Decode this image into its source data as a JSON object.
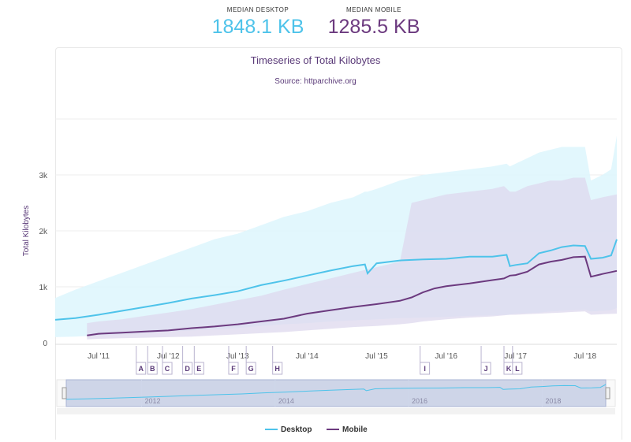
{
  "header": {
    "desktop_label": "MEDIAN DESKTOP",
    "desktop_value": "1848.1 KB",
    "mobile_label": "MEDIAN MOBILE",
    "mobile_value": "1285.5 KB"
  },
  "colors": {
    "desktop": "#4ec3ea",
    "mobile": "#6c3a7f",
    "desktop_band": "#dff6fd",
    "mobile_band": "#ddd8ee",
    "title": "#5a3a78"
  },
  "chart_data": {
    "type": "area",
    "title": "Timeseries of Total Kilobytes",
    "subtitle": "Source: httparchive.org",
    "xlabel": "",
    "ylabel": "Total Kilobytes",
    "ylim": [
      0,
      4000
    ],
    "xlim": [
      "2010-11-15",
      "2018-12-15"
    ],
    "yticks": [
      {
        "value": 0,
        "label": "0"
      },
      {
        "value": 1000,
        "label": "1k"
      },
      {
        "value": 2000,
        "label": "2k"
      },
      {
        "value": 3000,
        "label": "3k"
      }
    ],
    "xticks": [
      {
        "date": "2011-07-01",
        "label": "Jul '11"
      },
      {
        "date": "2012-07-01",
        "label": "Jul '12"
      },
      {
        "date": "2013-07-01",
        "label": "Jul '13"
      },
      {
        "date": "2014-07-01",
        "label": "Jul '14"
      },
      {
        "date": "2015-07-01",
        "label": "Jul '15"
      },
      {
        "date": "2016-07-01",
        "label": "Jul '16"
      },
      {
        "date": "2017-07-01",
        "label": "Jul '17"
      },
      {
        "date": "2018-07-01",
        "label": "Jul '18"
      }
    ],
    "series": [
      {
        "name": "Desktop",
        "x": [
          "2010-11-15",
          "2011-03-01",
          "2011-07-01",
          "2011-11-01",
          "2012-03-01",
          "2012-07-01",
          "2012-11-01",
          "2013-03-01",
          "2013-07-01",
          "2013-11-01",
          "2014-03-01",
          "2014-07-01",
          "2014-11-01",
          "2015-03-01",
          "2015-05-01",
          "2015-05-15",
          "2015-07-01",
          "2015-11-01",
          "2016-03-01",
          "2016-07-01",
          "2016-11-01",
          "2017-03-01",
          "2017-05-15",
          "2017-06-01",
          "2017-07-01",
          "2017-09-01",
          "2017-11-01",
          "2018-01-01",
          "2018-03-01",
          "2018-05-01",
          "2018-07-01",
          "2018-08-01",
          "2018-10-01",
          "2018-11-15",
          "2018-12-15"
        ],
        "values": [
          410,
          440,
          500,
          570,
          640,
          710,
          790,
          850,
          920,
          1030,
          1110,
          1200,
          1290,
          1370,
          1400,
          1240,
          1420,
          1470,
          1490,
          1500,
          1540,
          1540,
          1570,
          1370,
          1390,
          1420,
          1600,
          1650,
          1710,
          1740,
          1730,
          1500,
          1520,
          1560,
          1848
        ],
        "p10": [
          100,
          110,
          130,
          150,
          170,
          200,
          220,
          240,
          260,
          300,
          330,
          350,
          380,
          400,
          410,
          410,
          420,
          440,
          450,
          460,
          480,
          490,
          500,
          500,
          520,
          530,
          540,
          560,
          570,
          580,
          590,
          560,
          570,
          580,
          620
        ],
        "p90": [
          800,
          950,
          1100,
          1250,
          1400,
          1550,
          1700,
          1850,
          1950,
          2100,
          2250,
          2350,
          2500,
          2600,
          2700,
          2700,
          2750,
          2900,
          3000,
          3050,
          3100,
          3150,
          3200,
          3150,
          3200,
          3300,
          3400,
          3450,
          3500,
          3500,
          3500,
          2900,
          3000,
          3100,
          3700
        ]
      },
      {
        "name": "Mobile",
        "x": [
          "2011-05-01",
          "2011-07-01",
          "2011-11-01",
          "2012-03-01",
          "2012-07-01",
          "2012-11-01",
          "2013-03-01",
          "2013-07-01",
          "2013-11-01",
          "2014-03-01",
          "2014-07-01",
          "2014-11-01",
          "2015-03-01",
          "2015-07-01",
          "2015-11-01",
          "2016-01-01",
          "2016-03-01",
          "2016-05-01",
          "2016-07-01",
          "2016-11-01",
          "2017-03-01",
          "2017-05-01",
          "2017-06-01",
          "2017-07-01",
          "2017-09-01",
          "2017-11-01",
          "2018-01-01",
          "2018-03-01",
          "2018-05-01",
          "2018-07-01",
          "2018-08-01",
          "2018-10-01",
          "2018-12-15"
        ],
        "values": [
          130,
          160,
          180,
          200,
          220,
          260,
          290,
          330,
          380,
          430,
          520,
          580,
          640,
          690,
          750,
          810,
          900,
          970,
          1010,
          1060,
          1120,
          1150,
          1200,
          1210,
          1270,
          1400,
          1450,
          1480,
          1530,
          1540,
          1180,
          1230,
          1285
        ],
        "p10": [
          60,
          70,
          80,
          90,
          100,
          110,
          130,
          150,
          170,
          190,
          220,
          250,
          280,
          300,
          330,
          350,
          380,
          400,
          420,
          450,
          470,
          490,
          500,
          500,
          510,
          520,
          530,
          540,
          550,
          560,
          500,
          510,
          520
        ],
        "p90": [
          350,
          380,
          420,
          480,
          540,
          600,
          680,
          760,
          840,
          950,
          1050,
          1150,
          1250,
          1350,
          1450,
          2500,
          2550,
          2600,
          2650,
          2700,
          2750,
          2800,
          2700,
          2700,
          2800,
          2850,
          2900,
          2900,
          2950,
          2950,
          2550,
          2600,
          2650
        ]
      }
    ],
    "annotations": [
      {
        "label": "A",
        "date": "2012-01-15"
      },
      {
        "label": "B",
        "date": "2012-03-15"
      },
      {
        "label": "C",
        "date": "2012-06-01"
      },
      {
        "label": "D",
        "date": "2012-09-15"
      },
      {
        "label": "E",
        "date": "2012-11-15"
      },
      {
        "label": "F",
        "date": "2013-05-15"
      },
      {
        "label": "G",
        "date": "2013-08-15"
      },
      {
        "label": "H",
        "date": "2014-01-01"
      },
      {
        "label": "I",
        "date": "2016-02-15"
      },
      {
        "label": "J",
        "date": "2017-01-01"
      },
      {
        "label": "K",
        "date": "2017-05-01"
      },
      {
        "label": "L",
        "date": "2017-06-15"
      }
    ],
    "navigator": {
      "labels": [
        {
          "date": "2012-01-01",
          "label": "2012"
        },
        {
          "date": "2014-01-01",
          "label": "2014"
        },
        {
          "date": "2016-01-01",
          "label": "2016"
        },
        {
          "date": "2018-01-01",
          "label": "2018"
        }
      ]
    },
    "legend": [
      "Desktop",
      "Mobile"
    ],
    "legend_position": "bottom-center",
    "grid": true
  }
}
